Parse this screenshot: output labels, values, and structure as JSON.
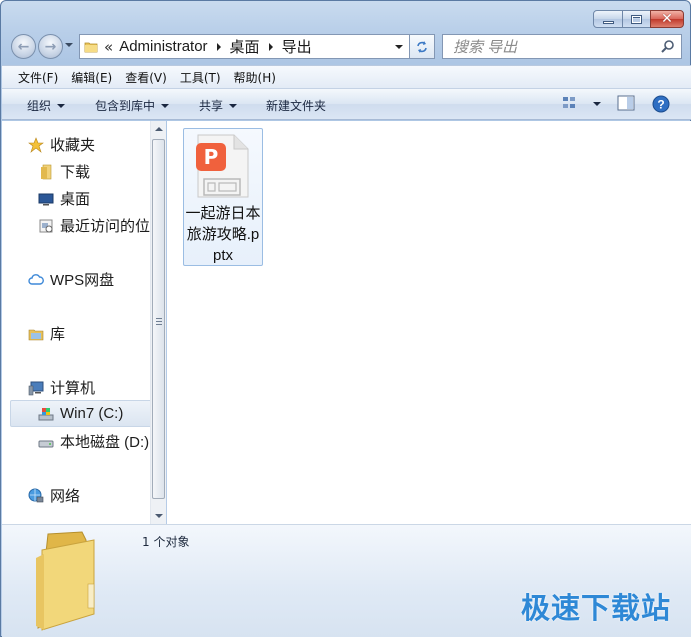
{
  "window": {
    "minimize_label": "",
    "maximize_label": "",
    "close_label": "✕"
  },
  "address": {
    "overflow": "«",
    "crumbs": [
      "Administrator",
      "桌面",
      "导出"
    ]
  },
  "search": {
    "placeholder": "搜索 导出"
  },
  "menu": [
    "文件(F)",
    "编辑(E)",
    "查看(V)",
    "工具(T)",
    "帮助(H)"
  ],
  "toolbar": {
    "organize": "组织",
    "include_in_library": "包含到库中",
    "share": "共享",
    "new_folder": "新建文件夹"
  },
  "nav": {
    "favorites": "收藏夹",
    "downloads": "下载",
    "desktop": "桌面",
    "recent": "最近访问的位置",
    "wps": "WPS网盘",
    "libraries": "库",
    "computer": "计算机",
    "drive_c": "Win7 (C:)",
    "drive_d": "本地磁盘 (D:)",
    "network": "网络"
  },
  "files": [
    {
      "name": "一起游日本旅游攻略.pptx",
      "icon": "wps-presentation-icon",
      "accent": "#f0613d"
    }
  ],
  "details": {
    "count": "1 个对象"
  },
  "watermark": "极速下载站",
  "colors": {
    "accent": "#2e88d6",
    "wps_orange": "#f0613d",
    "folder": "#f2d77a"
  }
}
